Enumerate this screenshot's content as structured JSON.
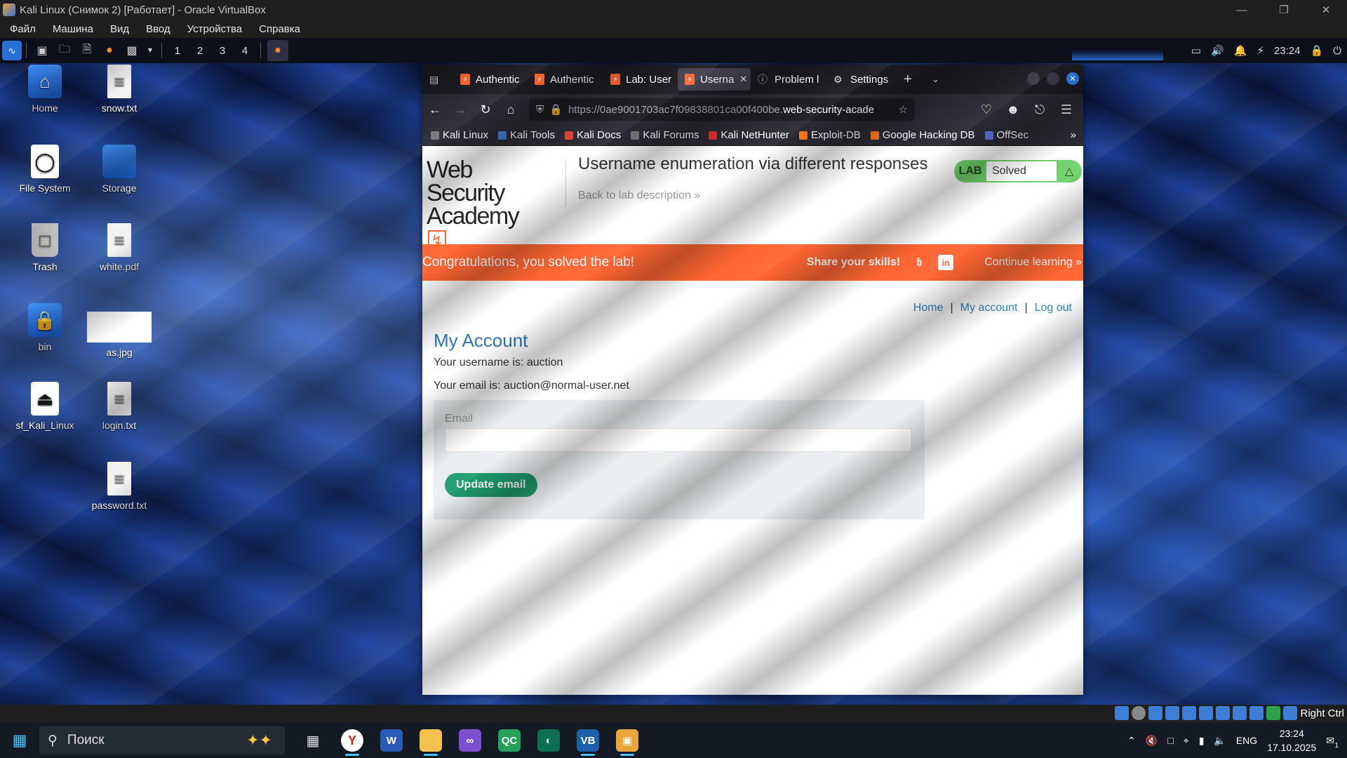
{
  "vbox": {
    "title": "Kali Linux  (Снимок 2) [Работает] - Oracle VirtualBox",
    "menu": [
      "Файл",
      "Машина",
      "Вид",
      "Ввод",
      "Устройства",
      "Справка"
    ],
    "status_right": "Right Ctrl"
  },
  "kali_panel": {
    "workspaces": [
      "1",
      "2",
      "3",
      "4"
    ],
    "clock": "23:24"
  },
  "desktop": {
    "icons": [
      "Home",
      "snow.txt",
      "File System",
      "Storage",
      "Trash",
      "white.pdf",
      "bin",
      "as.jpg",
      "sf_Kali_Linux",
      "login.txt",
      "password.txt"
    ]
  },
  "firefox": {
    "tabs": [
      "Authentic",
      "Authentic",
      "Lab: User",
      "Userna",
      "Problem l",
      "Settings"
    ],
    "url_prefix": "https://0ae9001703ac7f09838801ca00f400be.",
    "url_domain": "web-security-acade",
    "bookmarks": [
      "Kali Linux",
      "Kali Tools",
      "Kali Docs",
      "Kali Forums",
      "Kali NetHunter",
      "Exploit-DB",
      "Google Hacking DB",
      "OffSec"
    ]
  },
  "page": {
    "logo_line1": "Web Security",
    "logo_line2": "Academy",
    "lab_title": "Username enumeration via different responses",
    "back_link": "Back to lab description",
    "lab_badge": "LAB",
    "lab_status": "Solved",
    "congrats": "Congratulations, you solved the lab!",
    "share": "Share your skills!",
    "continue": "Continue learning",
    "nav_home": "Home",
    "nav_account": "My account",
    "nav_logout": "Log out",
    "heading": "My Account",
    "username_line": "Your username is: auction",
    "email_line": "Your email is: auction@normal-user.net",
    "email_label": "Email",
    "email_value": "",
    "update_button": "Update email"
  },
  "taskbar": {
    "search_placeholder": "Поиск",
    "lang": "ENG",
    "time": "23:24",
    "date": "17.10.2025",
    "notifications": "1"
  }
}
